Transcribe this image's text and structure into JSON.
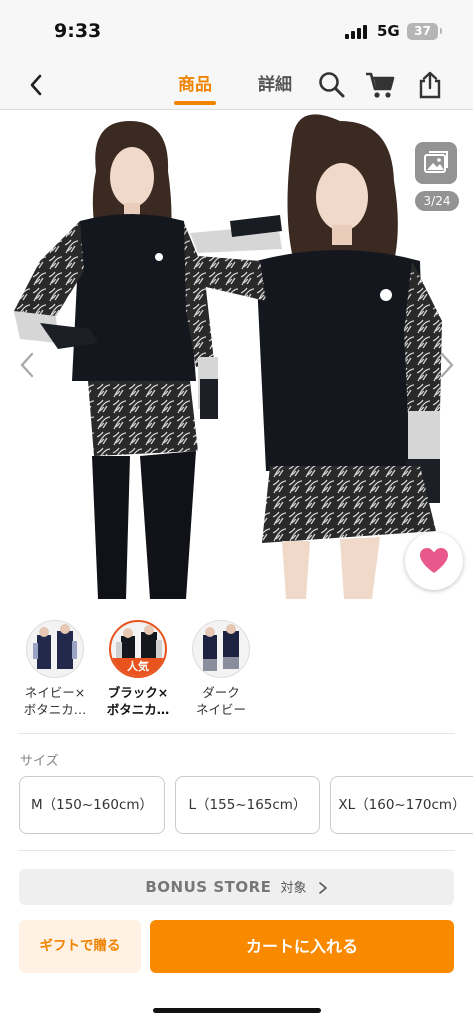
{
  "status_bar": {
    "time": "9:33",
    "network": "5G",
    "battery": "37"
  },
  "header": {
    "tabs": [
      {
        "label": "商品",
        "active": true
      },
      {
        "label": "詳細",
        "active": false
      }
    ]
  },
  "gallery": {
    "counter": "3/24"
  },
  "variants": [
    {
      "label_line1": "ネイビー×",
      "label_line2": "ボタニカ…",
      "selected": false
    },
    {
      "label_line1": "ブラック×",
      "label_line2": "ボタニカ…",
      "selected": true,
      "badge": "人気"
    },
    {
      "label_line1": "ダーク",
      "label_line2": "ネイビー",
      "selected": false
    }
  ],
  "sizes": {
    "title": "サイズ",
    "options": [
      "M（150~160cm）",
      "L（155~165cm）",
      "XL（160~170cm）"
    ]
  },
  "bonus": {
    "logo": "BONUS STORE",
    "text": "対象"
  },
  "actions": {
    "gift_label": "ギフトで贈る",
    "cart_label": "カートに入れる"
  },
  "colors": {
    "accent": "#f08300",
    "cart_button": "#f98a00",
    "gift_bg": "#fff1e3",
    "favorite": "#e8588a",
    "badge": "#e8531e"
  },
  "icons": {
    "back": "chevron-left-icon",
    "search": "search-icon",
    "cart": "cart-icon",
    "share": "share-icon",
    "gallery": "gallery-icon",
    "favorite": "heart-icon"
  }
}
